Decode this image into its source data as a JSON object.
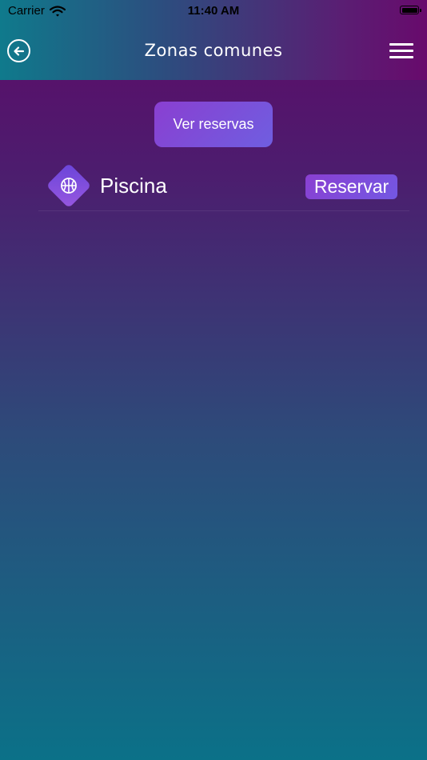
{
  "status_bar": {
    "carrier": "Carrier",
    "time": "11:40 AM"
  },
  "header": {
    "title": "Zonas comunes",
    "back_icon": "arrow-left-circle-icon",
    "menu_icon": "hamburger-menu-icon"
  },
  "main": {
    "ver_reservas_label": "Ver reservas",
    "items": [
      {
        "label": "Piscina",
        "icon": "basketball-icon",
        "action_label": "Reservar"
      }
    ]
  },
  "colors": {
    "gradient_top": "#5e0a68",
    "gradient_bottom": "#0b7188",
    "button_purple": "#8a3fd1",
    "button_blue_violet": "#6f5ee0"
  }
}
